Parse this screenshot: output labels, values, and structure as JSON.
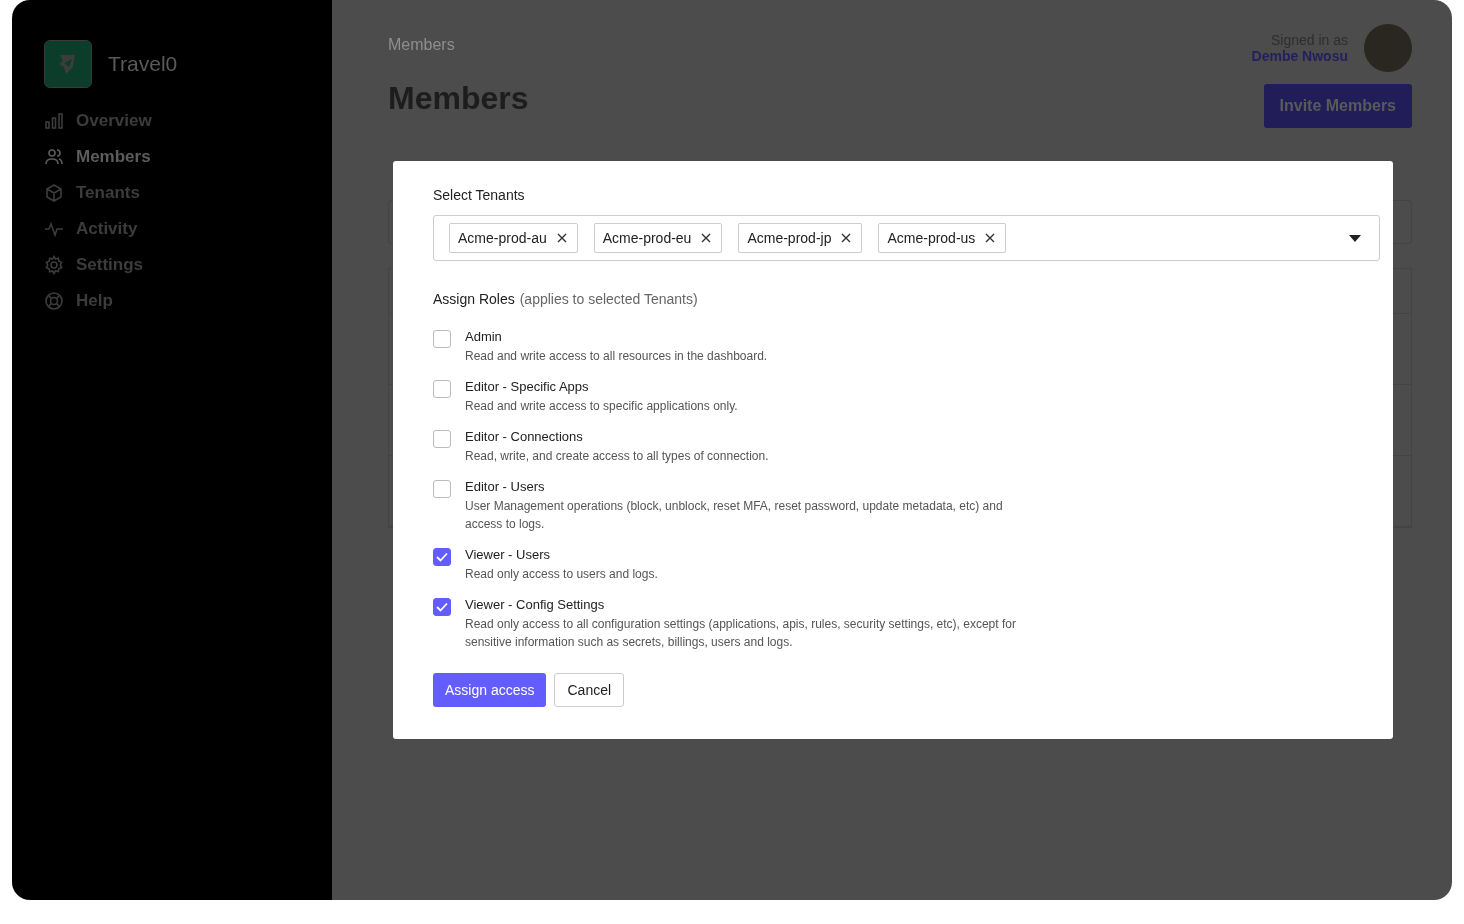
{
  "sidebar": {
    "brand": "Travel0",
    "items": [
      {
        "label": "Overview",
        "kind": "chart",
        "selected": false
      },
      {
        "label": "Members",
        "kind": "users",
        "selected": true
      },
      {
        "label": "Tenants",
        "kind": "cube",
        "selected": false
      },
      {
        "label": "Activity",
        "kind": "pulse",
        "selected": false
      },
      {
        "label": "Settings",
        "kind": "gear",
        "selected": false
      },
      {
        "label": "Help",
        "kind": "lifebuoy",
        "selected": false
      }
    ]
  },
  "header": {
    "breadcrumb": "Members",
    "title": "Members",
    "signed_in_label": "Signed in as",
    "user_name": "Dembe Nwosu",
    "invite_button": "Invite Members"
  },
  "modal": {
    "tenants_label": "Select Tenants",
    "tenants": [
      "Acme-prod-au",
      "Acme-prod-eu",
      "Acme-prod-jp",
      "Acme-prod-us"
    ],
    "roles_heading": "Assign Roles",
    "roles_hint": "(applies to selected Tenants)",
    "roles": [
      {
        "name": "Admin",
        "description": "Read and write access to all resources in the dashboard.",
        "checked": false
      },
      {
        "name": "Editor - Specific Apps",
        "description": "Read and write access to specific applications only.",
        "checked": false
      },
      {
        "name": "Editor - Connections",
        "description": "Read, write, and create access to all types of connection.",
        "checked": false
      },
      {
        "name": "Editor - Users",
        "description": "User Management operations (block, unblock, reset MFA, reset password, update metadata, etc) and access to logs.",
        "checked": false
      },
      {
        "name": "Viewer - Users",
        "description": "Read only access to users and logs.",
        "checked": true
      },
      {
        "name": "Viewer - Config Settings",
        "description": "Read only access to all configuration settings (applications, apis, rules, security settings, etc), except for sensitive information such as secrets, billings, users and logs.",
        "checked": true
      }
    ],
    "primary_button": "Assign access",
    "secondary_button": "Cancel"
  }
}
